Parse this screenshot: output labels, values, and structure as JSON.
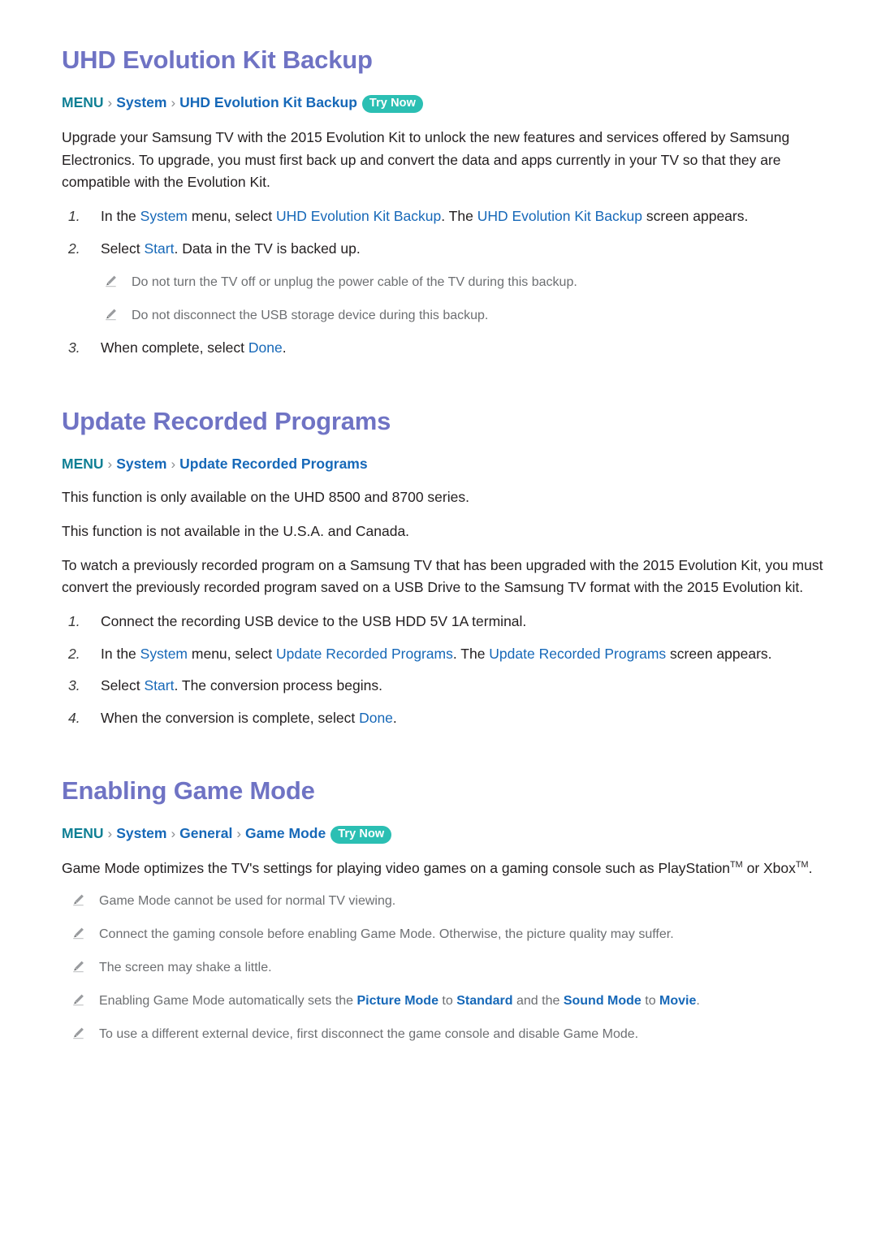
{
  "sections": [
    {
      "id": "uhd-evolution-kit-backup",
      "title": "UHD Evolution Kit Backup",
      "breadcrumb": {
        "menu": "MENU",
        "separator": "›",
        "items": [
          "System",
          "UHD Evolution Kit Backup"
        ],
        "badge": "Try Now"
      },
      "intro": "Upgrade your Samsung TV with the 2015 Evolution Kit to unlock the new features and services offered by Samsung Electronics. To upgrade, you must first back up and convert the data and apps currently in your TV so that they are compatible with the Evolution Kit.",
      "steps": [
        {
          "num": "1.",
          "parts": [
            {
              "t": "In the ",
              "s": "plain"
            },
            {
              "t": "System",
              "s": "hl"
            },
            {
              "t": " menu, select ",
              "s": "plain"
            },
            {
              "t": "UHD Evolution Kit Backup",
              "s": "hl"
            },
            {
              "t": ". The ",
              "s": "plain"
            },
            {
              "t": "UHD Evolution Kit Backup",
              "s": "hl"
            },
            {
              "t": " screen appears.",
              "s": "plain"
            }
          ]
        },
        {
          "num": "2.",
          "parts": [
            {
              "t": "Select ",
              "s": "plain"
            },
            {
              "t": "Start",
              "s": "hl"
            },
            {
              "t": ". Data in the TV is backed up.",
              "s": "plain"
            }
          ]
        },
        {
          "num": "3.",
          "parts": [
            {
              "t": "When complete, select ",
              "s": "plain"
            },
            {
              "t": "Done",
              "s": "hl"
            },
            {
              "t": ".",
              "s": "plain"
            }
          ]
        }
      ],
      "nested_notes": [
        "Do not turn the TV off or unplug the power cable of the TV during this backup.",
        "Do not disconnect the USB storage device during this backup."
      ]
    },
    {
      "id": "update-recorded-programs",
      "title": "Update Recorded Programs",
      "breadcrumb": {
        "menu": "MENU",
        "separator": "›",
        "items": [
          "System",
          "Update Recorded Programs"
        ],
        "badge": null
      },
      "paragraphs": [
        "This function is only available on the UHD 8500 and 8700 series.",
        "This function is not available in the U.S.A. and Canada.",
        "To watch a previously recorded program on a Samsung TV that has been upgraded with the 2015 Evolution Kit, you must convert the previously recorded program saved on a USB Drive to the Samsung TV format with the 2015 Evolution kit."
      ],
      "steps": [
        {
          "num": "1.",
          "parts": [
            {
              "t": "Connect the recording USB device to the USB HDD 5V 1A terminal.",
              "s": "plain"
            }
          ]
        },
        {
          "num": "2.",
          "parts": [
            {
              "t": "In the ",
              "s": "plain"
            },
            {
              "t": "System",
              "s": "hl"
            },
            {
              "t": " menu, select ",
              "s": "plain"
            },
            {
              "t": "Update Recorded Programs",
              "s": "hl"
            },
            {
              "t": ". The ",
              "s": "plain"
            },
            {
              "t": "Update Recorded Programs",
              "s": "hl"
            },
            {
              "t": " screen appears.",
              "s": "plain"
            }
          ]
        },
        {
          "num": "3.",
          "parts": [
            {
              "t": "Select ",
              "s": "plain"
            },
            {
              "t": "Start",
              "s": "hl"
            },
            {
              "t": ". The conversion process begins.",
              "s": "plain"
            }
          ]
        },
        {
          "num": "4.",
          "parts": [
            {
              "t": "When the conversion is complete, select ",
              "s": "plain"
            },
            {
              "t": "Done",
              "s": "hl"
            },
            {
              "t": ".",
              "s": "plain"
            }
          ]
        }
      ]
    },
    {
      "id": "enabling-game-mode",
      "title": "Enabling Game Mode",
      "breadcrumb": {
        "menu": "MENU",
        "separator": "›",
        "items": [
          "System",
          "General",
          "Game Mode"
        ],
        "badge": "Try Now"
      },
      "intro_parts": [
        {
          "t": "Game Mode optimizes the TV's settings for playing video games on a gaming console such as PlayStation",
          "s": "plain"
        },
        {
          "t": "TM",
          "s": "sup"
        },
        {
          "t": " or Xbox",
          "s": "plain"
        },
        {
          "t": "TM",
          "s": "sup"
        },
        {
          "t": ".",
          "s": "plain"
        }
      ],
      "notes": [
        [
          {
            "t": "Game Mode cannot be used for normal TV viewing.",
            "s": "plain"
          }
        ],
        [
          {
            "t": "Connect the gaming console before enabling Game Mode. Otherwise, the picture quality may suffer.",
            "s": "plain"
          }
        ],
        [
          {
            "t": "The screen may shake a little.",
            "s": "plain"
          }
        ],
        [
          {
            "t": "Enabling Game Mode automatically sets the ",
            "s": "plain"
          },
          {
            "t": "Picture Mode",
            "s": "hlb"
          },
          {
            "t": " to ",
            "s": "plain"
          },
          {
            "t": "Standard",
            "s": "hlb"
          },
          {
            "t": " and the ",
            "s": "plain"
          },
          {
            "t": "Sound Mode",
            "s": "hlb"
          },
          {
            "t": " to ",
            "s": "plain"
          },
          {
            "t": "Movie",
            "s": "hlb"
          },
          {
            "t": ".",
            "s": "plain"
          }
        ],
        [
          {
            "t": "To use a different external device, first disconnect the game console and disable Game Mode.",
            "s": "plain"
          }
        ]
      ]
    }
  ],
  "colors": {
    "heading": "#6f73c4",
    "menu": "#0e7f94",
    "link": "#1668b8",
    "badge_bg": "#2bbfb3",
    "note_text": "#6d6f72",
    "body_text": "#231f20"
  }
}
